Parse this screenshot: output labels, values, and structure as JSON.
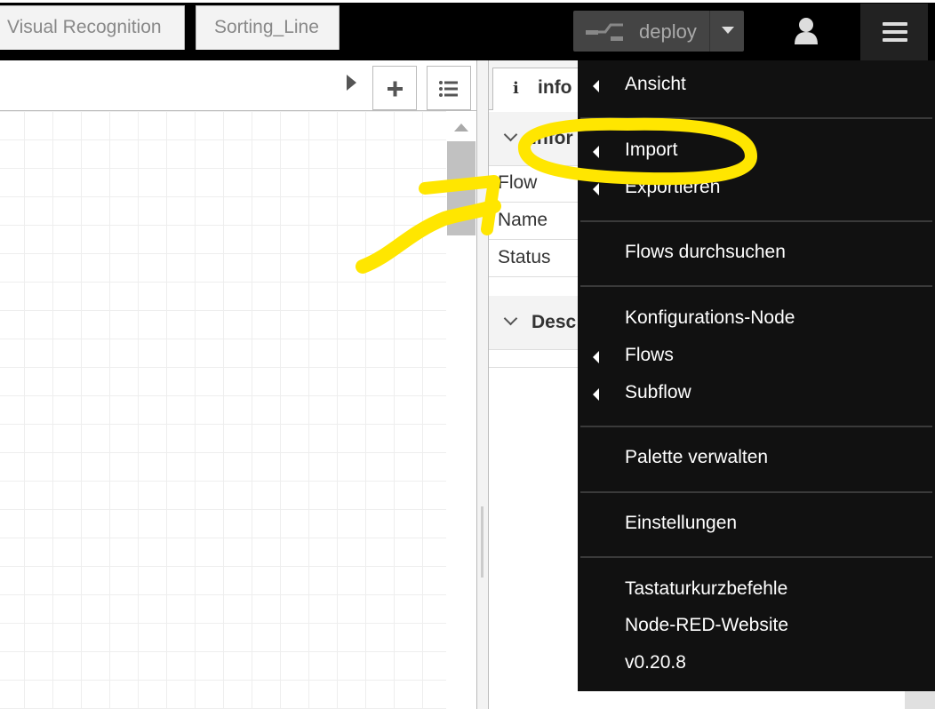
{
  "header": {
    "deploy_label": "deploy"
  },
  "workspace": {
    "tabs": [
      {
        "label": "Visual Recognition"
      },
      {
        "label": "Sorting_Line"
      }
    ]
  },
  "sidebar": {
    "tab_label": "info",
    "info_section_title": "Infor",
    "rows": [
      {
        "label": "Flow"
      },
      {
        "label": "Name"
      },
      {
        "label": "Status"
      }
    ],
    "description_section_title": "Desc"
  },
  "menu": {
    "items": [
      {
        "label": "Ansicht"
      },
      {
        "label": "Import"
      },
      {
        "label": "Exportieren"
      },
      {
        "label": "Flows durchsuchen"
      },
      {
        "label": "Konfigurations-Node"
      },
      {
        "label": "Flows"
      },
      {
        "label": "Subflow"
      },
      {
        "label": "Palette verwalten"
      },
      {
        "label": "Einstellungen"
      },
      {
        "label": "Tastaturkurzbefehle"
      },
      {
        "label": "Node-RED-Website"
      },
      {
        "label": "v0.20.8"
      }
    ]
  },
  "colors": {
    "header_bg": "#000000",
    "menu_bg": "#111111",
    "highlight": "#ffe600"
  }
}
